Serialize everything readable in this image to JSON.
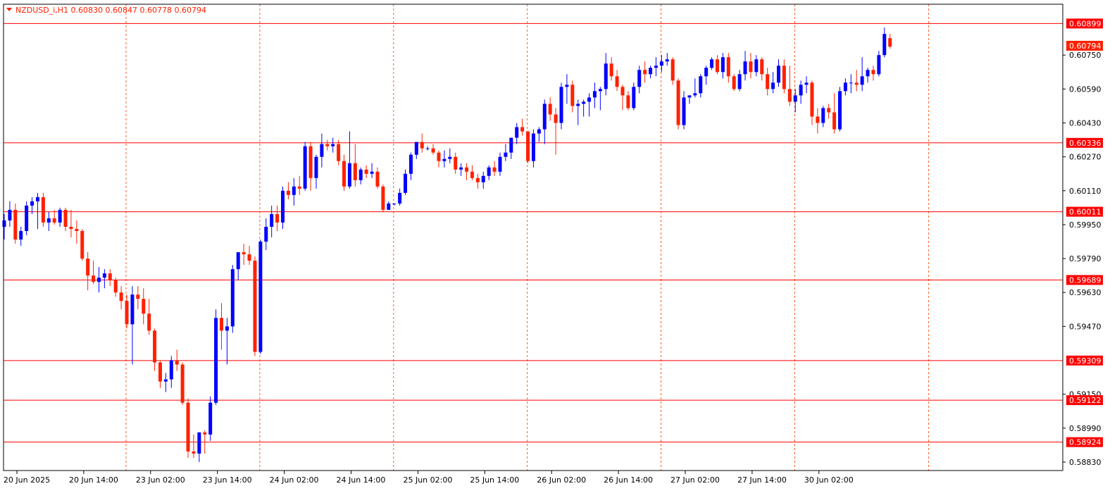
{
  "chart_data": {
    "type": "candlestick",
    "symbol_header": "NZDUSD_i,H1  0.60830 0.60847 0.60778 0.60794",
    "ylim": [
      0.5879,
      0.6099
    ],
    "y_ticks": [
      "0.60750",
      "0.60590",
      "0.60430",
      "0.60270",
      "0.60110",
      "0.59950",
      "0.59790",
      "0.59630",
      "0.59470",
      "0.59150",
      "0.58990",
      "0.58830"
    ],
    "x_tick_labels": [
      "20 Jun 2025",
      "20 Jun 14:00",
      "23 Jun 02:00",
      "23 Jun 14:00",
      "24 Jun 02:00",
      "24 Jun 14:00",
      "25 Jun 02:00",
      "25 Jun 14:00",
      "26 Jun 02:00",
      "26 Jun 14:00",
      "27 Jun 02:00",
      "27 Jun 14:00",
      "30 Jun 02:00"
    ],
    "price_levels": [
      "0.60899",
      "0.60336",
      "0.60011",
      "0.59689",
      "0.59309",
      "0.59122",
      "0.58924"
    ],
    "current_price": "0.60794",
    "colors": {
      "bull": "#0000ff",
      "bear": "#ff2000",
      "grid": "#ff5a1e",
      "levels": "#ff0000",
      "axis": "#000000"
    },
    "candles": [
      [
        0.5994,
        0.6,
        0.5988,
        0.5997
      ],
      [
        0.5997,
        0.6006,
        0.5994,
        0.6002
      ],
      [
        0.6002,
        0.6005,
        0.5986,
        0.5988
      ],
      [
        0.5988,
        0.5994,
        0.5985,
        0.5992
      ],
      [
        0.5992,
        0.6006,
        0.599,
        0.6004
      ],
      [
        0.6004,
        0.6008,
        0.6,
        0.6006
      ],
      [
        0.6006,
        0.601,
        0.5993,
        0.6008
      ],
      [
        0.6008,
        0.601,
        0.5994,
        0.5996
      ],
      [
        0.5996,
        0.6001,
        0.5992,
        0.5998
      ],
      [
        0.5998,
        0.6002,
        0.5995,
        0.5996
      ],
      [
        0.5996,
        0.6003,
        0.5994,
        0.6002
      ],
      [
        0.6002,
        0.6003,
        0.5992,
        0.5994
      ],
      [
        0.5994,
        0.6002,
        0.5989,
        0.5993
      ],
      [
        0.5993,
        0.5997,
        0.5986,
        0.5992
      ],
      [
        0.5992,
        0.5993,
        0.5978,
        0.5979
      ],
      [
        0.5979,
        0.5982,
        0.5964,
        0.5971
      ],
      [
        0.5971,
        0.5978,
        0.5967,
        0.5968
      ],
      [
        0.5968,
        0.5975,
        0.5963,
        0.597
      ],
      [
        0.597,
        0.5974,
        0.5965,
        0.5972
      ],
      [
        0.5972,
        0.5974,
        0.5966,
        0.5969
      ],
      [
        0.5969,
        0.597,
        0.5961,
        0.5963
      ],
      [
        0.5963,
        0.5966,
        0.5955,
        0.5959
      ],
      [
        0.5959,
        0.5962,
        0.5946,
        0.5948
      ],
      [
        0.5948,
        0.5966,
        0.5929,
        0.5962
      ],
      [
        0.5962,
        0.5966,
        0.5955,
        0.596
      ],
      [
        0.596,
        0.5965,
        0.5948,
        0.5953
      ],
      [
        0.5953,
        0.596,
        0.5943,
        0.5945
      ],
      [
        0.5945,
        0.5946,
        0.5926,
        0.593
      ],
      [
        0.593,
        0.5931,
        0.5918,
        0.5921
      ],
      [
        0.5921,
        0.5925,
        0.5916,
        0.5922
      ],
      [
        0.5922,
        0.5933,
        0.5918,
        0.5931
      ],
      [
        0.5931,
        0.5936,
        0.5926,
        0.5929
      ],
      [
        0.5929,
        0.593,
        0.591,
        0.5911
      ],
      [
        0.5911,
        0.5913,
        0.5885,
        0.5888
      ],
      [
        0.5888,
        0.5896,
        0.5885,
        0.5887
      ],
      [
        0.5887,
        0.5897,
        0.5883,
        0.5897
      ],
      [
        0.5897,
        0.5898,
        0.5887,
        0.5896
      ],
      [
        0.5896,
        0.5914,
        0.5893,
        0.5911
      ],
      [
        0.5911,
        0.5955,
        0.591,
        0.5951
      ],
      [
        0.5951,
        0.5958,
        0.5936,
        0.5945
      ],
      [
        0.5945,
        0.5951,
        0.5929,
        0.5947
      ],
      [
        0.5947,
        0.5976,
        0.5944,
        0.5974
      ],
      [
        0.5974,
        0.5982,
        0.5969,
        0.5982
      ],
      [
        0.5982,
        0.5986,
        0.5976,
        0.5981
      ],
      [
        0.5981,
        0.5985,
        0.5976,
        0.5978
      ],
      [
        0.5978,
        0.598,
        0.5933,
        0.5935
      ],
      [
        0.5935,
        0.5988,
        0.5934,
        0.5987
      ],
      [
        0.5987,
        0.5998,
        0.5983,
        0.5994
      ],
      [
        0.5994,
        0.6004,
        0.5989,
        0.6
      ],
      [
        0.6,
        0.6004,
        0.5992,
        0.5996
      ],
      [
        0.5996,
        0.6013,
        0.5993,
        0.6011
      ],
      [
        0.6011,
        0.6015,
        0.6007,
        0.6009
      ],
      [
        0.6009,
        0.6017,
        0.6004,
        0.6013
      ],
      [
        0.6013,
        0.6018,
        0.6009,
        0.6012
      ],
      [
        0.6012,
        0.6034,
        0.6011,
        0.6032
      ],
      [
        0.6032,
        0.6034,
        0.6011,
        0.6017
      ],
      [
        0.6017,
        0.6028,
        0.6012,
        0.6027
      ],
      [
        0.6027,
        0.6038,
        0.6022,
        0.6033
      ],
      [
        0.6033,
        0.6035,
        0.603,
        0.6032
      ],
      [
        0.6032,
        0.6036,
        0.6029,
        0.6033
      ],
      [
        0.6033,
        0.6035,
        0.6023,
        0.6025
      ],
      [
        0.6025,
        0.6028,
        0.6011,
        0.6013
      ],
      [
        0.6013,
        0.6039,
        0.6012,
        0.6024
      ],
      [
        0.6024,
        0.6033,
        0.6013,
        0.6016
      ],
      [
        0.6016,
        0.6022,
        0.6014,
        0.6021
      ],
      [
        0.6021,
        0.6023,
        0.6017,
        0.6019
      ],
      [
        0.6019,
        0.6024,
        0.6017,
        0.602
      ],
      [
        0.602,
        0.6022,
        0.6012,
        0.6013
      ],
      [
        0.6013,
        0.6014,
        0.6001,
        0.6002
      ],
      [
        0.6002,
        0.6006,
        0.6002,
        0.6005
      ],
      [
        0.6005,
        0.6005,
        0.6004,
        0.6005
      ],
      [
        0.6005,
        0.6012,
        0.6004,
        0.601
      ],
      [
        0.601,
        0.6021,
        0.6009,
        0.6019
      ],
      [
        0.6019,
        0.6029,
        0.6016,
        0.6028
      ],
      [
        0.6028,
        0.6034,
        0.6026,
        0.6034
      ],
      [
        0.6034,
        0.6038,
        0.6029,
        0.6031
      ],
      [
        0.6031,
        0.6032,
        0.603,
        0.6031
      ],
      [
        0.6031,
        0.6033,
        0.6028,
        0.6029
      ],
      [
        0.6029,
        0.603,
        0.6022,
        0.6025
      ],
      [
        0.6025,
        0.603,
        0.6022,
        0.6026
      ],
      [
        0.6026,
        0.6031,
        0.6024,
        0.6027
      ],
      [
        0.6027,
        0.6029,
        0.6019,
        0.6021
      ],
      [
        0.6021,
        0.6024,
        0.6018,
        0.6022
      ],
      [
        0.6022,
        0.6024,
        0.6016,
        0.602
      ],
      [
        0.602,
        0.6023,
        0.6016,
        0.6017
      ],
      [
        0.6017,
        0.6019,
        0.6012,
        0.6015
      ],
      [
        0.6015,
        0.602,
        0.6012,
        0.6018
      ],
      [
        0.6018,
        0.6023,
        0.6016,
        0.6022
      ],
      [
        0.6022,
        0.6025,
        0.6018,
        0.602
      ],
      [
        0.602,
        0.6029,
        0.6018,
        0.6027
      ],
      [
        0.6027,
        0.6033,
        0.6025,
        0.6029
      ],
      [
        0.6029,
        0.6036,
        0.6026,
        0.6036
      ],
      [
        0.6036,
        0.6043,
        0.6033,
        0.6041
      ],
      [
        0.6041,
        0.6045,
        0.6037,
        0.6039
      ],
      [
        0.6039,
        0.6039,
        0.6024,
        0.6025
      ],
      [
        0.6025,
        0.604,
        0.6022,
        0.6038
      ],
      [
        0.6038,
        0.6041,
        0.6034,
        0.604
      ],
      [
        0.604,
        0.6054,
        0.6033,
        0.6052
      ],
      [
        0.6052,
        0.6055,
        0.6044,
        0.6047
      ],
      [
        0.6047,
        0.605,
        0.6028,
        0.6043
      ],
      [
        0.6043,
        0.6062,
        0.604,
        0.606
      ],
      [
        0.606,
        0.6066,
        0.6052,
        0.6061
      ],
      [
        0.6061,
        0.6063,
        0.6048,
        0.6051
      ],
      [
        0.6051,
        0.6054,
        0.6042,
        0.6052
      ],
      [
        0.6052,
        0.6054,
        0.6046,
        0.6053
      ],
      [
        0.6053,
        0.6057,
        0.6046,
        0.6055
      ],
      [
        0.6055,
        0.6062,
        0.605,
        0.6058
      ],
      [
        0.6058,
        0.606,
        0.6049,
        0.6059
      ],
      [
        0.6059,
        0.6076,
        0.6056,
        0.6071
      ],
      [
        0.6071,
        0.6074,
        0.6063,
        0.6065
      ],
      [
        0.6065,
        0.6068,
        0.6058,
        0.606
      ],
      [
        0.606,
        0.6061,
        0.6049,
        0.6056
      ],
      [
        0.6056,
        0.6058,
        0.6049,
        0.605
      ],
      [
        0.605,
        0.6062,
        0.6049,
        0.606
      ],
      [
        0.606,
        0.607,
        0.6057,
        0.6068
      ],
      [
        0.6068,
        0.6072,
        0.6062,
        0.6066
      ],
      [
        0.6066,
        0.607,
        0.6064,
        0.6069
      ],
      [
        0.6069,
        0.6074,
        0.6065,
        0.607
      ],
      [
        0.607,
        0.6075,
        0.6067,
        0.6072
      ],
      [
        0.6072,
        0.6076,
        0.607,
        0.6073
      ],
      [
        0.6073,
        0.6074,
        0.6061,
        0.6063
      ],
      [
        0.6063,
        0.6064,
        0.604,
        0.6042
      ],
      [
        0.6042,
        0.6058,
        0.604,
        0.6055
      ],
      [
        0.6055,
        0.6056,
        0.6052,
        0.6056
      ],
      [
        0.6056,
        0.6064,
        0.6055,
        0.6057
      ],
      [
        0.6057,
        0.6066,
        0.6055,
        0.6065
      ],
      [
        0.6065,
        0.607,
        0.6061,
        0.6069
      ],
      [
        0.6069,
        0.6074,
        0.6068,
        0.6073
      ],
      [
        0.6073,
        0.6075,
        0.6066,
        0.6067
      ],
      [
        0.6067,
        0.6076,
        0.6064,
        0.6074
      ],
      [
        0.6074,
        0.6076,
        0.6062,
        0.6065
      ],
      [
        0.6065,
        0.6066,
        0.6058,
        0.6059
      ],
      [
        0.6059,
        0.6068,
        0.6058,
        0.6066
      ],
      [
        0.6066,
        0.6077,
        0.6063,
        0.6072
      ],
      [
        0.6072,
        0.6076,
        0.6064,
        0.6067
      ],
      [
        0.6067,
        0.6075,
        0.6065,
        0.6073
      ],
      [
        0.6073,
        0.6074,
        0.6063,
        0.6066
      ],
      [
        0.6066,
        0.6069,
        0.6056,
        0.6059
      ],
      [
        0.6059,
        0.6067,
        0.6057,
        0.6062
      ],
      [
        0.6062,
        0.6073,
        0.606,
        0.607
      ],
      [
        0.607,
        0.6073,
        0.6057,
        0.6059
      ],
      [
        0.6059,
        0.607,
        0.6051,
        0.6053
      ],
      [
        0.6053,
        0.6059,
        0.6048,
        0.6056
      ],
      [
        0.6056,
        0.6063,
        0.6052,
        0.6061
      ],
      [
        0.6061,
        0.6065,
        0.6057,
        0.6062
      ],
      [
        0.6062,
        0.6063,
        0.6042,
        0.6046
      ],
      [
        0.6046,
        0.605,
        0.6038,
        0.6043
      ],
      [
        0.6043,
        0.6051,
        0.6041,
        0.605
      ],
      [
        0.605,
        0.6052,
        0.6045,
        0.6048
      ],
      [
        0.6048,
        0.6057,
        0.6038,
        0.604
      ],
      [
        0.604,
        0.606,
        0.6039,
        0.6058
      ],
      [
        0.6058,
        0.6064,
        0.6056,
        0.6062
      ],
      [
        0.6062,
        0.6066,
        0.6057,
        0.6062
      ],
      [
        0.6062,
        0.6068,
        0.6058,
        0.6061
      ],
      [
        0.6061,
        0.6074,
        0.6058,
        0.6065
      ],
      [
        0.6065,
        0.6069,
        0.6062,
        0.6068
      ],
      [
        0.6068,
        0.607,
        0.6063,
        0.6066
      ],
      [
        0.6066,
        0.6077,
        0.6065,
        0.6075
      ],
      [
        0.6075,
        0.6088,
        0.6074,
        0.6085
      ],
      [
        0.6083,
        0.6085,
        0.6078,
        0.6079
      ]
    ]
  }
}
